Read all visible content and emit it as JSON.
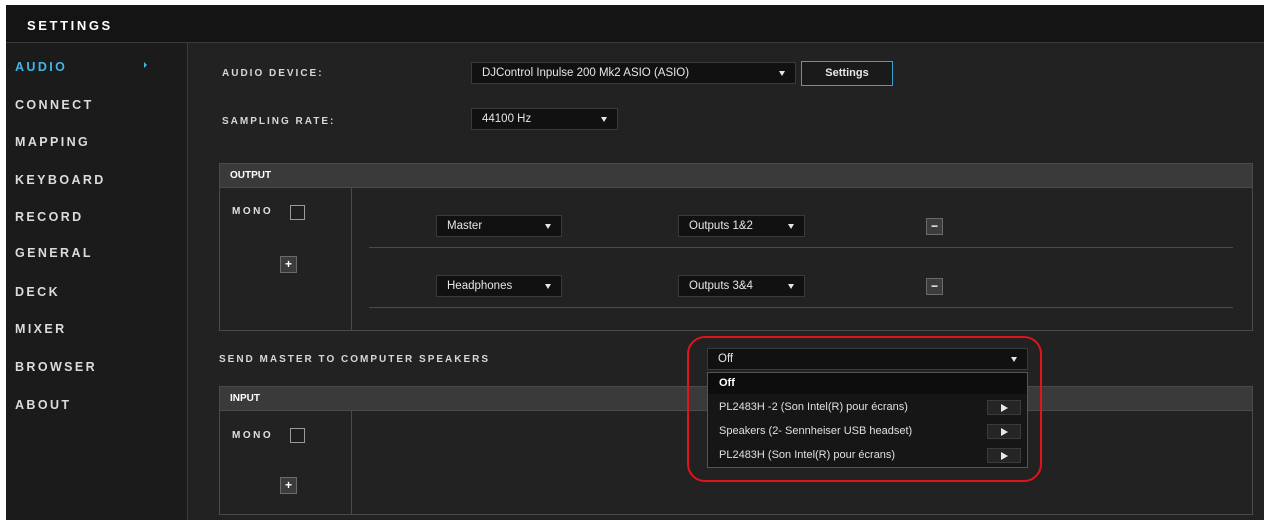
{
  "window": {
    "title": "SETTINGS"
  },
  "sidebar": {
    "items": [
      {
        "label": "AUDIO",
        "active": true
      },
      {
        "label": "CONNECT"
      },
      {
        "label": "MAPPING"
      },
      {
        "label": "KEYBOARD"
      },
      {
        "label": "RECORD"
      },
      {
        "label": "GENERAL"
      },
      {
        "label": "DECK"
      },
      {
        "label": "MIXER"
      },
      {
        "label": "BROWSER"
      },
      {
        "label": "ABOUT"
      }
    ]
  },
  "audio": {
    "device_label": "AUDIO DEVICE:",
    "device_value": "DJControl Inpulse 200 Mk2 ASIO (ASIO)",
    "settings_button": "Settings",
    "sampling_label": "SAMPLING RATE:",
    "sampling_value": "44100 Hz"
  },
  "output": {
    "header": "OUTPUT",
    "mono_label": "MONO",
    "add_label": "+",
    "rows": [
      {
        "channel": "Master",
        "outputs": "Outputs 1&2",
        "remove_label": "−"
      },
      {
        "channel": "Headphones",
        "outputs": "Outputs 3&4",
        "remove_label": "−"
      }
    ]
  },
  "send_master": {
    "label": "SEND MASTER TO COMPUTER SPEAKERS",
    "value": "Off",
    "options": [
      {
        "label": "Off",
        "selected": true
      },
      {
        "label": "PL2483H -2 (Son Intel(R) pour écrans)"
      },
      {
        "label": "Speakers (2- Sennheiser USB headset)"
      },
      {
        "label": "PL2483H (Son Intel(R) pour écrans)"
      }
    ]
  },
  "input": {
    "header": "INPUT",
    "mono_label": "MONO",
    "add_label": "+"
  },
  "colors": {
    "accent": "#3fb6e8",
    "highlight_ring": "#e0141b",
    "background": "#222222"
  }
}
